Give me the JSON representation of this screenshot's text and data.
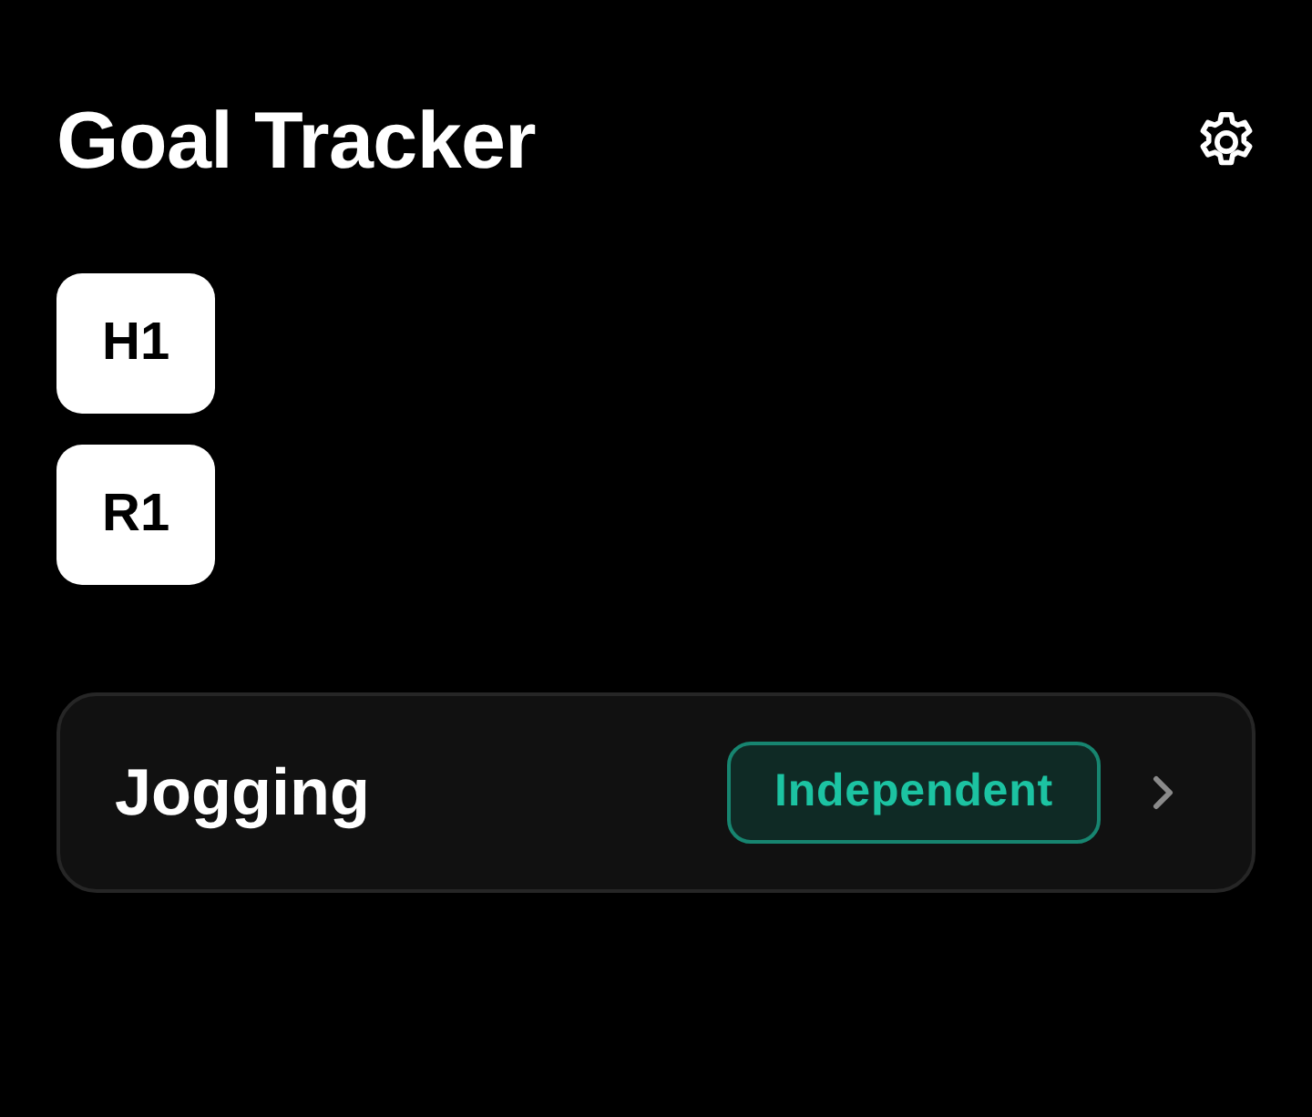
{
  "header": {
    "title": "Goal Tracker"
  },
  "tags": [
    {
      "label": "H1"
    },
    {
      "label": "R1"
    }
  ],
  "goals": [
    {
      "name": "Jogging",
      "badge": "Independent"
    }
  ]
}
